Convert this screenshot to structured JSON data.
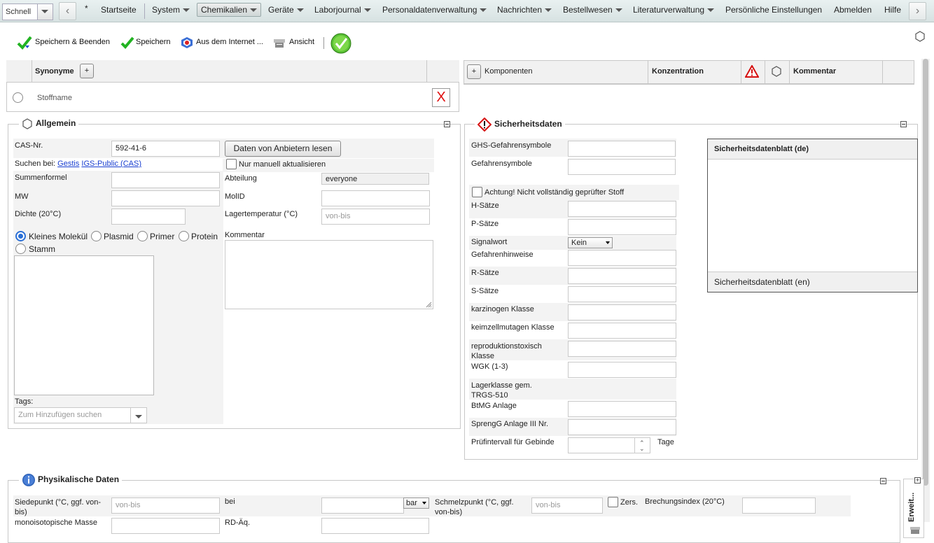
{
  "menubar": {
    "quick_select": "Schnell",
    "home_icon": "*",
    "items": [
      "Startseite",
      "System",
      "Chemikalien",
      "Geräte",
      "Laborjournal",
      "Personaldatenverwaltung",
      "Nachrichten",
      "Bestellwesen",
      "Literaturverwaltung",
      "Persönliche Einstellungen",
      "Abmelden",
      "Hilfe"
    ],
    "active": "Chemikalien"
  },
  "toolbar": {
    "save_close": "Speichern & Beenden",
    "save": "Speichern",
    "from_internet": "Aus dem Internet ...",
    "view": "Ansicht"
  },
  "synonyms": {
    "header": "Synonyme",
    "add": "+",
    "row_label": "Stoffname",
    "delete": "X"
  },
  "components": {
    "add": "+",
    "col_components": "Komponenten",
    "col_concentration": "Konzentration",
    "col_comment": "Kommentar"
  },
  "general": {
    "legend": "Allgemein",
    "cas_label": "CAS-Nr.",
    "cas_value": "592-41-6",
    "fetch_button": "Daten von Anbietern lesen",
    "search_label": "Suchen bei:",
    "search_link1": "Gestis",
    "search_link2": "IGS-Public (CAS)",
    "manual_update": "Nur manuell aktualisieren",
    "formula_label": "Summenformel",
    "department_label": "Abteilung",
    "department_value": "everyone",
    "mw_label": "MW",
    "molid_label": "MolID",
    "density_label": "Dichte (20°C)",
    "storage_temp_label": "Lagertemperatur (°C)",
    "storage_temp_placeholder": "von-bis",
    "type_options": [
      "Kleines Molekül",
      "Plasmid",
      "Primer",
      "Protein",
      "Stamm"
    ],
    "type_selected": "Kleines Molekül",
    "comment_label": "Kommentar",
    "tags_label": "Tags:",
    "tags_placeholder": "Zum Hinzufügen suchen"
  },
  "safety": {
    "legend": "Sicherheitsdaten",
    "ghs_symbols": "GHS-Gefahrensymbole",
    "hazard_symbols": "Gefahrensymbole",
    "warning_check": "Achtung! Nicht vollständig geprüfter Stoff",
    "h_phrases": "H-Sätze",
    "p_phrases": "P-Sätze",
    "signal_word": "Signalwort",
    "signal_value": "Kein",
    "hazard_notes": "Gefahrenhinweise",
    "r_phrases": "R-Sätze",
    "s_phrases": "S-Sätze",
    "carcinogen": "karzinogen Klasse",
    "mutagen": "keimzellmutagen Klasse",
    "reprotox": "reproduktionstoxisch Klasse",
    "wgk": "WGK (1-3)",
    "storage_class": "Lagerklasse gem. TRGS-510",
    "btmg": "BtMG Anlage",
    "sprengg": "SprengG Anlage III Nr.",
    "interval": "Prüfintervall für Gebinde",
    "interval_unit": "Tage",
    "sds_de": "Sicherheitsdatenblatt (de)",
    "sds_en": "Sicherheitsdatenblatt (en)"
  },
  "physical": {
    "legend": "Physikalische Daten",
    "boiling_label": "Siedepunkt (°C, ggf. von-bis)",
    "range_placeholder": "von-bis",
    "at_label": "bei",
    "unit_value": "bar",
    "melting_label": "Schmelzpunkt (°C, ggf. von-bis)",
    "decomp_label": "Zers.",
    "refraction_label": "Brechungsindex (20°C)",
    "mono_mass_label": "monoisotopische Masse",
    "rd_label": "RD-Äq.",
    "extended_tab": "Erweit..."
  }
}
